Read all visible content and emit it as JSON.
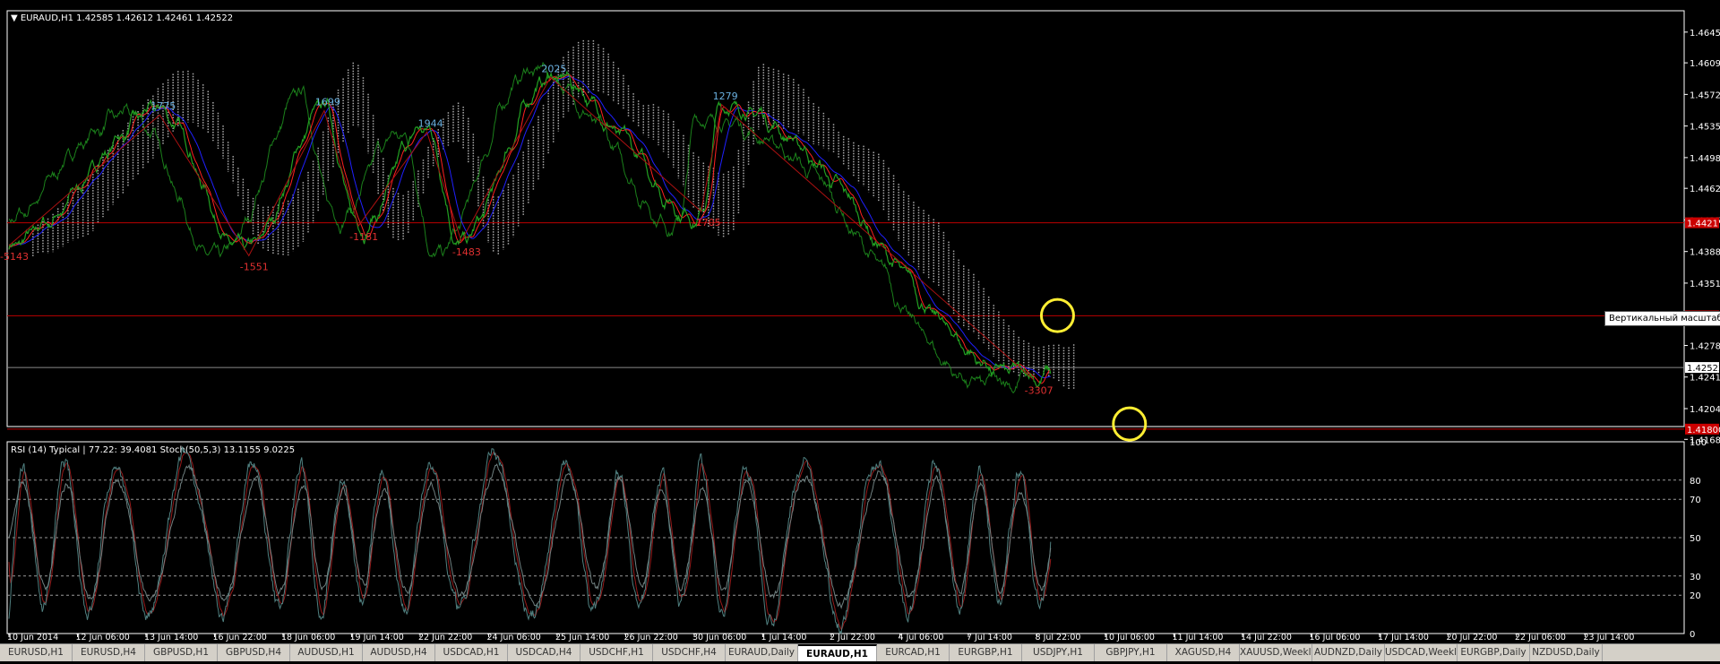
{
  "window": {
    "header": "EURAUD,H1  1.42585 1.42612 1.42461 1.42522",
    "tooltip": "Вертикальный масштаб"
  },
  "colors": {
    "background": "#000000",
    "frame": "#ffffff",
    "price_line": "#22a022",
    "kijun": "#2020ff",
    "tenkan": "#ff2020",
    "cloud": "#c8c8c8",
    "zigzag": "#aa1111",
    "annotation": "#ffee33",
    "level_line": "#bb0000",
    "zz_high_label": "#6ab0e0",
    "zz_low_label": "#e03030",
    "rsi": "#708080",
    "stoch_main": "#508080",
    "stoch_signal": "#bb2020"
  },
  "chart_data": [
    {
      "type": "line",
      "title": "EURAUD,H1",
      "ylim": [
        1.4183,
        1.467
      ],
      "y_ticks": [
        "1.46450",
        "1.46090",
        "1.45720",
        "1.45350",
        "1.44980",
        "1.44620",
        "1.44250",
        "1.43880",
        "1.43510",
        "1.43140",
        "1.42780",
        "1.42410",
        "1.42040",
        "1.41680"
      ],
      "price_labels": [
        {
          "text": "1.42522",
          "value": 1.42522
        },
        {
          "text": "1.44217",
          "value": 1.44217
        },
        {
          "text": "1.43127",
          "value": 1.43127
        },
        {
          "text": "1.41800",
          "value": 1.418
        }
      ],
      "horizontal_levels": [
        1.44217,
        1.43127,
        1.42522,
        1.418
      ],
      "x_labels": [
        "10 Jun 2014",
        "12 Jun 06:00",
        "13 Jun 14:00",
        "16 Jun 22:00",
        "18 Jun 06:00",
        "19 Jun 14:00",
        "22 Jun 22:00",
        "24 Jun 06:00",
        "25 Jun 14:00",
        "26 Jun 22:00",
        "30 Jun 06:00",
        "1 Jul 14:00",
        "2 Jul 22:00",
        "4 Jul 06:00",
        "7 Jul 14:00",
        "8 Jul 22:00",
        "10 Jul 06:00",
        "11 Jul 14:00",
        "14 Jul 22:00",
        "16 Jul 06:00",
        "17 Jul 14:00",
        "20 Jul 22:00",
        "22 Jul 06:00",
        "23 Jul 14:00"
      ],
      "zigzag_points": [
        {
          "i": 0,
          "value": 1.4395,
          "label": "-5143"
        },
        {
          "i": 2.2,
          "value": 1.4548,
          "label": "1775"
        },
        {
          "i": 3.5,
          "value": 1.4383,
          "label": "-1551"
        },
        {
          "i": 4.6,
          "value": 1.4553,
          "label": "1699"
        },
        {
          "i": 5.1,
          "value": 1.4418,
          "label": "-1181"
        },
        {
          "i": 6.1,
          "value": 1.4528,
          "label": "1944"
        },
        {
          "i": 6.6,
          "value": 1.44,
          "label": "-1483"
        },
        {
          "i": 7.9,
          "value": 1.4592,
          "label": "2025"
        },
        {
          "i": 10.1,
          "value": 1.4435,
          "label": "-1705"
        },
        {
          "i": 10.4,
          "value": 1.456,
          "label": "1279"
        },
        {
          "i": 14.95,
          "value": 1.4238,
          "label": "-3307"
        }
      ],
      "annotation_line": [
        {
          "i": 0.4,
          "value": 1.4387
        },
        {
          "i": 7.9,
          "value": 1.4593
        },
        {
          "i": 10.05,
          "value": 1.4433
        },
        {
          "i": 10.4,
          "value": 1.456
        },
        {
          "i": 14.95,
          "value": 1.4237
        },
        {
          "i": 15.35,
          "value": 1.431
        },
        {
          "i": 16.35,
          "value": 1.4183
        }
      ],
      "annotation_circles": [
        {
          "i": 15.3,
          "value": 1.4313
        },
        {
          "i": 16.35,
          "value": 1.4186
        }
      ]
    },
    {
      "type": "line",
      "title": "RSI (14) Typical | 77.22: 39.4081  Stoch(50,5,3) 13.1155 9.0225",
      "ylim": [
        0,
        100
      ],
      "y_ticks": [
        "100",
        "80",
        "70",
        "50",
        "30",
        "20",
        "0"
      ],
      "levels": [
        80,
        70,
        50,
        30,
        20
      ],
      "annotation_path": [
        {
          "i": 15.0,
          "value": 40
        },
        {
          "i": 15.45,
          "value": 58
        },
        {
          "i": 16.2,
          "value": 20
        },
        {
          "i": 16.4,
          "value": 32
        },
        {
          "i": 16.95,
          "value": 0
        }
      ]
    }
  ],
  "tabs": [
    {
      "label": "EURUSD,H1"
    },
    {
      "label": "EURUSD,H4"
    },
    {
      "label": "GBPUSD,H1"
    },
    {
      "label": "GBPUSD,H4"
    },
    {
      "label": "AUDUSD,H1"
    },
    {
      "label": "AUDUSD,H4"
    },
    {
      "label": "USDCAD,H1"
    },
    {
      "label": "USDCAD,H4"
    },
    {
      "label": "USDCHF,H1"
    },
    {
      "label": "USDCHF,H4"
    },
    {
      "label": "EURAUD,Daily"
    },
    {
      "label": "EURAUD,H1",
      "active": true
    },
    {
      "label": "EURCAD,H1"
    },
    {
      "label": "EURGBP,H1"
    },
    {
      "label": "USDJPY,H1"
    },
    {
      "label": "GBPJPY,H1"
    },
    {
      "label": "XAGUSD,H4"
    },
    {
      "label": "XAUUSD,Weekly"
    },
    {
      "label": "AUDNZD,Daily"
    },
    {
      "label": "USDCAD,Weekly"
    },
    {
      "label": "EURGBP,Daily"
    },
    {
      "label": "NZDUSD,Daily"
    }
  ]
}
